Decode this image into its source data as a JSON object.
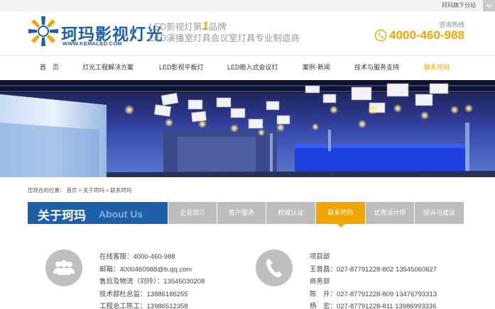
{
  "topbar": {
    "link": "珂玛旗下分站"
  },
  "header": {
    "logo_cn": "珂玛影视灯光",
    "logo_en": "WWW.KEMALED.COM",
    "slogan_prefix": "LED影视灯第",
    "slogan_num": "1",
    "slogan_suffix": "品牌",
    "slogan_line2": "LED演播室灯具会议室灯具专业制造商",
    "hotline_label": "咨询热线",
    "phone": "4000-460-988"
  },
  "nav": [
    {
      "label": "首　页"
    },
    {
      "label": "灯光工程解决方案"
    },
    {
      "label": "LED影视平板灯"
    },
    {
      "label": "LED嵌入式会议灯"
    },
    {
      "label": "案例·新闻"
    },
    {
      "label": "技术与服务支持"
    },
    {
      "label": "联系珂玛"
    }
  ],
  "breadcrumb": {
    "prefix": "您现在的位置：",
    "home": "首页",
    "sep1": ">",
    "parent": "关于珂玛",
    "sep2": ">",
    "current": "联系珂玛"
  },
  "section": {
    "title_cn": "关于珂玛",
    "title_en": "About Us",
    "tabs": [
      {
        "label": "企业简介"
      },
      {
        "label": "客户服务"
      },
      {
        "label": "权威认证"
      },
      {
        "label": "联系珂玛"
      },
      {
        "label": "优秀设计师"
      },
      {
        "label": "投诉与建议"
      }
    ]
  },
  "contact_left": [
    "在线客服：4000-460-988",
    "邮箱：4000460988@b.qq.com",
    "售后及物流（刘玲）：13545030208",
    "技术部杜总监：13886186255",
    "工程总工陈工：13986512358"
  ],
  "contact_right": [
    "项目部",
    "王普昌：027-87791228-802 13545060627",
    "商务部",
    "陈　升：027-87791228-809 13476793313",
    "杨　宏：027-87791228-811 13986993336"
  ],
  "colors": {
    "brand_blue": "#1f5fa7",
    "accent": "#f0a500",
    "tab_gray": "#bdbdbd"
  }
}
